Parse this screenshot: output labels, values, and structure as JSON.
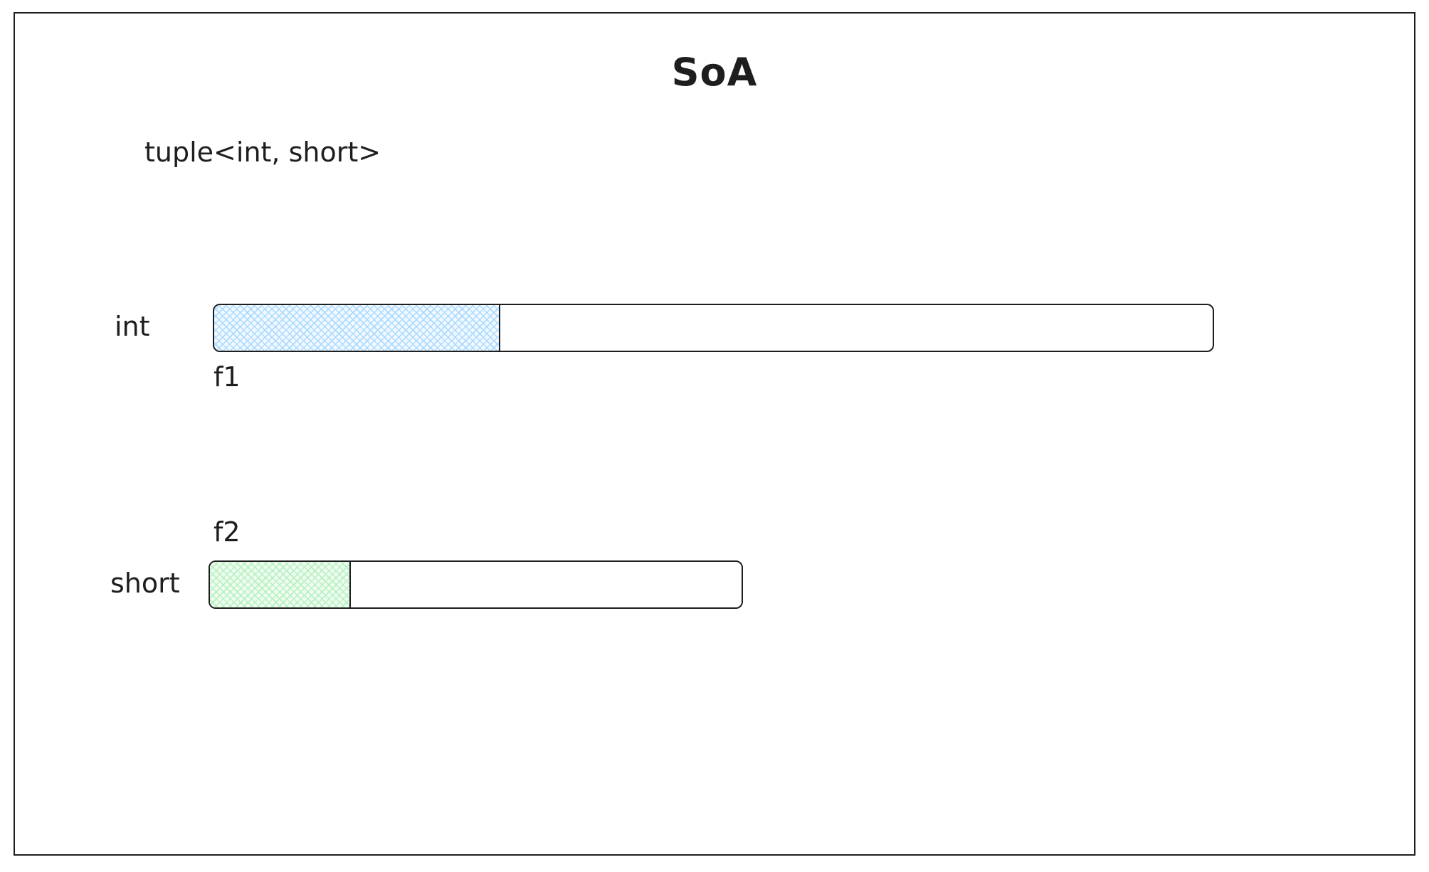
{
  "diagram": {
    "title": "SoA",
    "subtitle": "tuple<int, short>",
    "rows": [
      {
        "type_label": "int",
        "field_label": "f1",
        "fill_color": "#a5d8ff",
        "filled_fraction": 0.285
      },
      {
        "type_label": "short",
        "field_label": "f2",
        "fill_color": "#b2f2bb",
        "filled_fraction": 0.262
      }
    ]
  }
}
